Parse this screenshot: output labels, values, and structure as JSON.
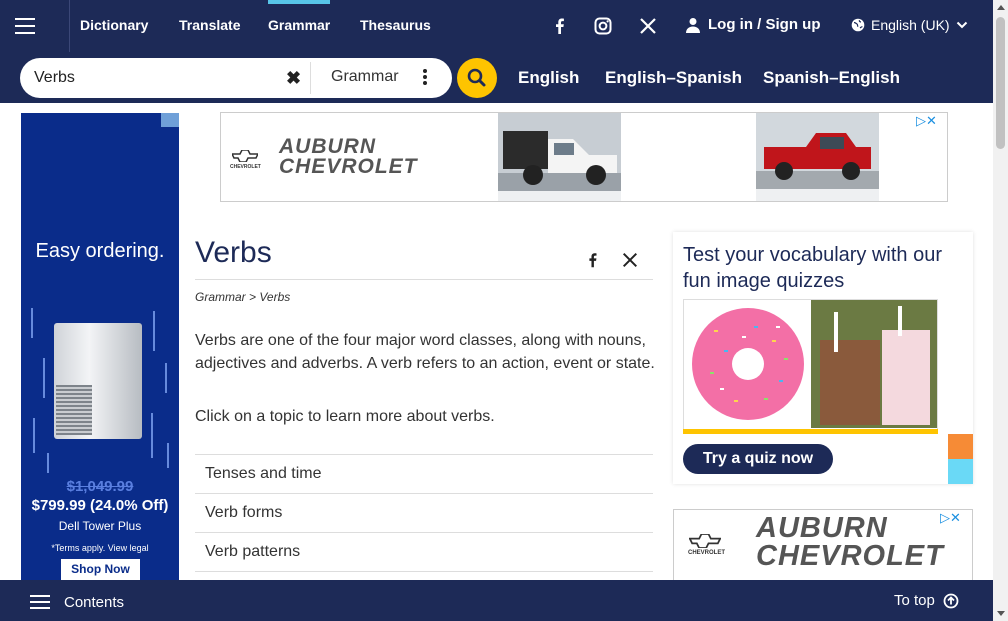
{
  "nav": {
    "links": [
      "Dictionary",
      "Translate",
      "Grammar",
      "Thesaurus"
    ],
    "active": "Grammar",
    "login": "Log in / Sign up",
    "language": "English (UK)"
  },
  "search": {
    "value": "Verbs",
    "dictionary": "Grammar",
    "dict_links": [
      "English",
      "English–Spanish",
      "Spanish–English"
    ]
  },
  "left_ad": {
    "headline": "Easy ordering.",
    "old_price": "$1,049.99",
    "new_price": "$799.99 (24.0% Off)",
    "product": "Dell Tower Plus",
    "terms": "*Terms apply. View legal",
    "cta": "Shop Now",
    "color": "#0a2c8a"
  },
  "banner_ad": {
    "brand": "CHEVROLET",
    "dealer_line1": "AUBURN",
    "dealer_line2": "CHEVROLET",
    "marker": "▷✕"
  },
  "article": {
    "title": "Verbs",
    "breadcrumb": "Grammar > Verbs",
    "intro": "Verbs are one of the four major word classes, along with nouns, adjectives and adverbs. A verb refers to an action, event or state.",
    "prompt": "Click on a topic to learn more about verbs.",
    "topics": [
      "Tenses and time",
      "Verb forms",
      "Verb patterns"
    ]
  },
  "quiz": {
    "title": "Test your vocabulary with our fun image quizzes",
    "button": "Try a quiz now"
  },
  "bottom": {
    "contents": "Contents",
    "totop": "To top"
  },
  "colors": {
    "navy": "#1d2a57",
    "accent": "#58c5e8",
    "yellow": "#fec400"
  },
  "icons": [
    "menu-icon",
    "facebook-icon",
    "instagram-icon",
    "x-icon",
    "user-icon",
    "globe-icon",
    "chevron-down-icon",
    "clear-icon",
    "more-icon",
    "search-icon",
    "arrow-up-circle-icon"
  ]
}
